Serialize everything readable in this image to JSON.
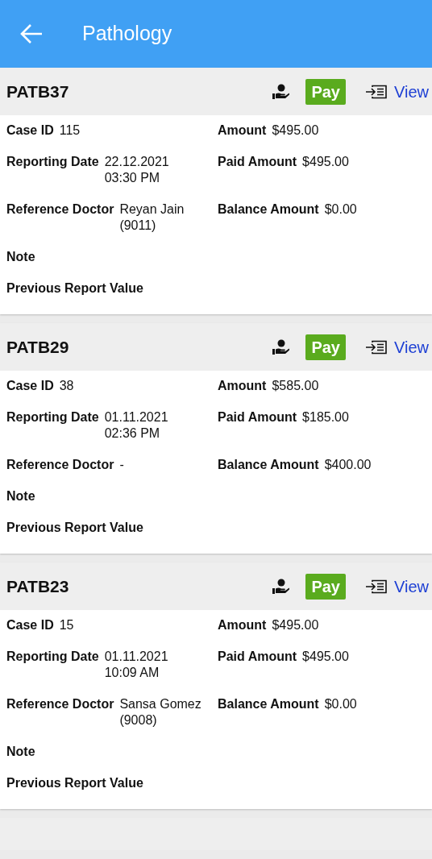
{
  "app_bar": {
    "title": "Pathology"
  },
  "cards": [
    {
      "code": "PATB37",
      "pay_label": "Pay",
      "view_label": "View",
      "rows": [
        {
          "left": {
            "label": "Case ID",
            "value": "115"
          },
          "right": {
            "label": "Amount",
            "value": "$495.00"
          }
        },
        {
          "left": {
            "label": "Reporting Date",
            "value": "22.12.2021\n03:30 PM"
          },
          "right": {
            "label": "Paid Amount",
            "value": "$495.00"
          }
        },
        {
          "left": {
            "label": "Reference Doctor",
            "value": "Reyan Jain\n(9011)"
          },
          "right": {
            "label": "Balance Amount",
            "value": "$0.00"
          }
        },
        {
          "left": {
            "label": "Note"
          }
        },
        {
          "left": {
            "label": "Previous Report Value"
          }
        }
      ]
    },
    {
      "code": "PATB29",
      "pay_label": "Pay",
      "view_label": "View",
      "rows": [
        {
          "left": {
            "label": "Case ID",
            "value": "38"
          },
          "right": {
            "label": "Amount",
            "value": "$585.00"
          }
        },
        {
          "left": {
            "label": "Reporting Date",
            "value": "01.11.2021\n02:36 PM"
          },
          "right": {
            "label": "Paid Amount",
            "value": "$185.00"
          }
        },
        {
          "left": {
            "label": "Reference Doctor",
            "value": "-"
          },
          "right": {
            "label": "Balance Amount",
            "value": "$400.00"
          }
        },
        {
          "left": {
            "label": "Note"
          }
        },
        {
          "left": {
            "label": "Previous Report Value"
          }
        }
      ]
    },
    {
      "code": "PATB23",
      "pay_label": "Pay",
      "view_label": "View",
      "rows": [
        {
          "left": {
            "label": "Case ID",
            "value": "15"
          },
          "right": {
            "label": "Amount",
            "value": "$495.00"
          }
        },
        {
          "left": {
            "label": "Reporting Date",
            "value": "01.11.2021\n10:09 AM"
          },
          "right": {
            "label": "Paid Amount",
            "value": "$495.00"
          }
        },
        {
          "left": {
            "label": "Reference Doctor",
            "value": "Sansa Gomez\n(9008)"
          },
          "right": {
            "label": "Balance Amount",
            "value": "$0.00"
          }
        },
        {
          "left": {
            "label": "Note"
          }
        },
        {
          "left": {
            "label": "Previous Report Value"
          }
        }
      ]
    }
  ]
}
